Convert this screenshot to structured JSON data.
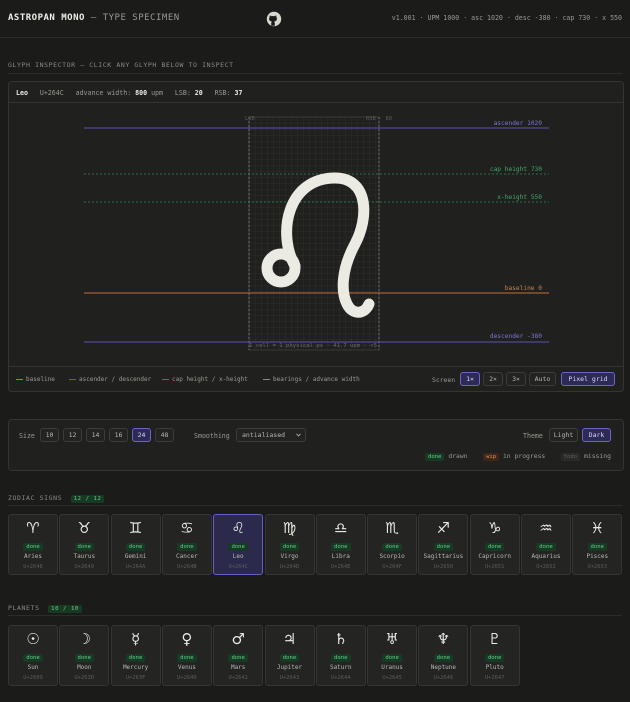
{
  "header": {
    "brand": "ASTROPAN MONO",
    "subtitle": "— TYPE SPECIMEN",
    "meta": "v1.001 · UPM 1000 · asc 1020 · desc -380 · cap 730 · x 550"
  },
  "inspector": {
    "section_title": "GLYPH INSPECTOR — CLICK ANY GLYPH BELOW TO INSPECT",
    "glyph_name": "Leo",
    "codepoint": "U+264C",
    "advance_label": "advance width:",
    "advance_value": "800",
    "advance_unit": "upm",
    "lsb_label": "LSB:",
    "lsb_value": "20",
    "rsb_label": "RSB:",
    "rsb_value": "37",
    "lsb_marker": "LSB",
    "rsb_marker": "RSB · 80",
    "metrics": {
      "ascender": "ascender 1020",
      "cap_height": "cap height 730",
      "x_height": "x-height 550",
      "baseline": "baseline 0",
      "descender": "descender -380"
    },
    "grid_caption": "1 cell = 1 physical px · 41.7 upm · ×5",
    "legend": {
      "baseline": "baseline",
      "asc_desc": "ascender / descender",
      "cap_x": "cap height / x-height",
      "bearings": "bearings / advance width"
    },
    "screen_label": "Screen",
    "screen_options": [
      "1×",
      "2×",
      "3×",
      "Auto"
    ],
    "screen_selected": "1×",
    "pixel_grid_label": "Pixel grid",
    "colors": {
      "baseline": "#c0703f",
      "asc_desc": "#5a53b8",
      "cap_x": "#2f8a55",
      "bearings": "#8a8a83"
    }
  },
  "controls": {
    "size_label": "Size",
    "sizes": [
      "10",
      "12",
      "14",
      "16",
      "24",
      "48"
    ],
    "size_selected": "24",
    "smoothing_label": "Smoothing",
    "smoothing_value": "antialiased",
    "theme_label": "Theme",
    "theme_options": [
      "Light",
      "Dark"
    ],
    "theme_selected": "Dark",
    "status_legend": [
      {
        "pill": "done",
        "label": "drawn"
      },
      {
        "pill": "wip",
        "label": "in progress"
      },
      {
        "pill": "todo",
        "label": "missing"
      }
    ]
  },
  "zodiac": {
    "title": "ZODIAC SIGNS",
    "count": "12 / 12",
    "items": [
      {
        "glyph": "♈",
        "name": "Aries",
        "code": "U+2648",
        "status": "done"
      },
      {
        "glyph": "♉",
        "name": "Taurus",
        "code": "U+2649",
        "status": "done"
      },
      {
        "glyph": "♊",
        "name": "Gemini",
        "code": "U+264A",
        "status": "done"
      },
      {
        "glyph": "♋",
        "name": "Cancer",
        "code": "U+264B",
        "status": "done"
      },
      {
        "glyph": "♌",
        "name": "Leo",
        "code": "U+264C",
        "status": "done"
      },
      {
        "glyph": "♍",
        "name": "Virgo",
        "code": "U+264D",
        "status": "done"
      },
      {
        "glyph": "♎",
        "name": "Libra",
        "code": "U+264E",
        "status": "done"
      },
      {
        "glyph": "♏",
        "name": "Scorpio",
        "code": "U+264F",
        "status": "done"
      },
      {
        "glyph": "♐",
        "name": "Sagittarius",
        "code": "U+2650",
        "status": "done"
      },
      {
        "glyph": "♑",
        "name": "Capricorn",
        "code": "U+2651",
        "status": "done"
      },
      {
        "glyph": "♒",
        "name": "Aquarius",
        "code": "U+2652",
        "status": "done"
      },
      {
        "glyph": "♓",
        "name": "Pisces",
        "code": "U+2653",
        "status": "done"
      }
    ]
  },
  "planets": {
    "title": "PLANETS",
    "count": "10 / 10",
    "items": [
      {
        "glyph": "☉",
        "name": "Sun",
        "code": "U+2609",
        "status": "done"
      },
      {
        "glyph": "☽",
        "name": "Moon",
        "code": "U+263D",
        "status": "done"
      },
      {
        "glyph": "☿",
        "name": "Mercury",
        "code": "U+263F",
        "status": "done"
      },
      {
        "glyph": "♀",
        "name": "Venus",
        "code": "U+2640",
        "status": "done"
      },
      {
        "glyph": "♂",
        "name": "Mars",
        "code": "U+2642",
        "status": "done"
      },
      {
        "glyph": "♃",
        "name": "Jupiter",
        "code": "U+2643",
        "status": "done"
      },
      {
        "glyph": "♄",
        "name": "Saturn",
        "code": "U+2644",
        "status": "done"
      },
      {
        "glyph": "♅",
        "name": "Uranus",
        "code": "U+2645",
        "status": "done"
      },
      {
        "glyph": "♆",
        "name": "Neptune",
        "code": "U+2646",
        "status": "done"
      },
      {
        "glyph": "♇",
        "name": "Pluto",
        "code": "U+2647",
        "status": "done"
      }
    ]
  },
  "icons": {
    "github": "github-icon",
    "chevron": "chevron-down-icon"
  }
}
